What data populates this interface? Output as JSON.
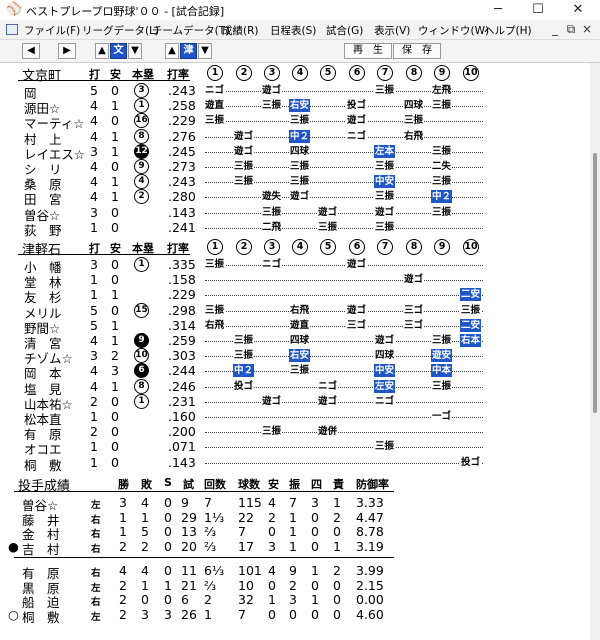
{
  "window": {
    "title": "ベストプレープロ野球'００ - [試合記録]",
    "controls": {
      "minimize": "─",
      "maximize": "☐",
      "close": "✕"
    }
  },
  "menu": {
    "items": [
      "ファイル(F)",
      "リーグデータ(L)",
      "チームデータ(T)",
      "成績(R)",
      "日程表(S)",
      "試合(G)",
      "表示(V)",
      "ウィンドウ(W)",
      "ヘルプ(H)"
    ],
    "mdi_controls": [
      "_",
      "⧉",
      "×"
    ]
  },
  "toolbar": {
    "prev": "◀",
    "next": "▶",
    "team1_up": "▲",
    "team1_label": "文",
    "team1_down": "▼",
    "team2_up": "▲",
    "team2_label": "津",
    "team2_down": "▼",
    "replay": "再　生",
    "save": "保　存"
  },
  "columns": {
    "at_bats": "打",
    "hits": "安",
    "homers": "本塁",
    "avg": "打率"
  },
  "innings": [
    "1",
    "2",
    "3",
    "4",
    "5",
    "6",
    "7",
    "8",
    "9",
    "10"
  ],
  "teams": [
    {
      "name": "文京町",
      "players": [
        {
          "pos": "",
          "name": "岡",
          "ab": "5",
          "h": "0",
          "hr": "3",
          "hr_filled": false,
          "avg": ".243",
          "results": [
            {
              "i": 1,
              "t": "ニゴ"
            },
            {
              "i": 3,
              "t": "遊ゴ"
            },
            {
              "i": 7,
              "t": "三振"
            },
            {
              "i": 9,
              "t": "左飛"
            }
          ]
        },
        {
          "pos": "",
          "name": "源田☆",
          "ab": "4",
          "h": "1",
          "hr": "1",
          "hr_filled": false,
          "avg": ".258",
          "results": [
            {
              "i": 1,
              "t": "遊直"
            },
            {
              "i": 3,
              "t": "三振"
            },
            {
              "i": 4,
              "t": "右安",
              "hit": true
            },
            {
              "i": 6,
              "t": "投ゴ"
            },
            {
              "i": 8,
              "t": "四球"
            },
            {
              "i": 9,
              "t": "三振"
            }
          ]
        },
        {
          "pos": "",
          "name": "マーティ☆",
          "ab": "4",
          "h": "0",
          "hr": "16",
          "hr_filled": false,
          "avg": ".229",
          "results": [
            {
              "i": 1,
              "t": "三振"
            },
            {
              "i": 4,
              "t": "三振"
            },
            {
              "i": 6,
              "t": "遊ゴ"
            },
            {
              "i": 8,
              "t": "三振"
            }
          ]
        },
        {
          "pos": "",
          "name": "村　上",
          "ab": "4",
          "h": "1",
          "hr": "8",
          "hr_filled": false,
          "avg": ".276",
          "results": [
            {
              "i": 2,
              "t": "遊ゴ"
            },
            {
              "i": 4,
              "t": "中２",
              "hit": true
            },
            {
              "i": 6,
              "t": "ニゴ"
            },
            {
              "i": 8,
              "t": "右飛"
            }
          ]
        },
        {
          "pos": "",
          "name": "レイエス☆",
          "ab": "3",
          "h": "1",
          "hr": "12",
          "hr_filled": true,
          "avg": ".245",
          "results": [
            {
              "i": 2,
              "t": "遊ゴ"
            },
            {
              "i": 4,
              "t": "四球"
            },
            {
              "i": 7,
              "t": "左本",
              "hit": true
            },
            {
              "i": 9,
              "t": "三振"
            }
          ]
        },
        {
          "pos": "",
          "name": "シ　リ",
          "ab": "4",
          "h": "0",
          "hr": "9",
          "hr_filled": false,
          "avg": ".273",
          "results": [
            {
              "i": 2,
              "t": "三振"
            },
            {
              "i": 4,
              "t": "三振"
            },
            {
              "i": 7,
              "t": "三振"
            },
            {
              "i": 9,
              "t": "二失"
            }
          ]
        },
        {
          "pos": "",
          "name": "桑　原",
          "ab": "4",
          "h": "1",
          "hr": "4",
          "hr_filled": false,
          "avg": ".243",
          "results": [
            {
              "i": 2,
              "t": "三振"
            },
            {
              "i": 4,
              "t": "三振"
            },
            {
              "i": 7,
              "t": "中安",
              "hit": true
            },
            {
              "i": 9,
              "t": "三振"
            }
          ]
        },
        {
          "pos": "",
          "name": "田　宮",
          "ab": "4",
          "h": "1",
          "hr": "2",
          "hr_filled": false,
          "avg": ".280",
          "results": [
            {
              "i": 3,
              "t": "遊失"
            },
            {
              "i": 4,
              "t": "遊ゴ"
            },
            {
              "i": 7,
              "t": "三振"
            },
            {
              "i": 9,
              "t": "中２",
              "hit": true
            }
          ]
        },
        {
          "pos": "",
          "name": "曽谷☆",
          "ab": "3",
          "h": "0",
          "hr": "",
          "hr_filled": false,
          "avg": ".143",
          "results": [
            {
              "i": 3,
              "t": "三振"
            },
            {
              "i": 5,
              "t": "遊ゴ"
            },
            {
              "i": 7,
              "t": "遊ゴ"
            },
            {
              "i": 9,
              "t": "三振"
            }
          ]
        },
        {
          "pos": "",
          "name": "荻　野",
          "ab": "1",
          "h": "0",
          "hr": "",
          "hr_filled": false,
          "avg": ".241",
          "results": [
            {
              "i": 3,
              "t": "二飛"
            },
            {
              "i": 5,
              "t": "三振"
            },
            {
              "i": 7,
              "t": "三振"
            }
          ]
        }
      ]
    },
    {
      "name": "津軽石",
      "players": [
        {
          "pos": "",
          "name": "小　幡",
          "ab": "3",
          "h": "0",
          "hr": "1",
          "hr_filled": false,
          "avg": ".335",
          "results": [
            {
              "i": 1,
              "t": "三振"
            },
            {
              "i": 3,
              "t": "ニゴ"
            },
            {
              "i": 6,
              "t": "遊ゴ"
            }
          ]
        },
        {
          "pos": "",
          "name": "堂　林",
          "ab": "1",
          "h": "0",
          "hr": "",
          "hr_filled": false,
          "avg": ".158",
          "results": [
            {
              "i": 8,
              "t": "遊ゴ"
            }
          ]
        },
        {
          "pos": "",
          "name": "友　杉",
          "ab": "1",
          "h": "1",
          "hr": "",
          "hr_filled": false,
          "avg": ".229",
          "results": [
            {
              "i": 10,
              "t": "二安",
              "hit": true
            }
          ]
        },
        {
          "pos": "",
          "name": "メリル",
          "ab": "5",
          "h": "0",
          "hr": "15",
          "hr_filled": false,
          "avg": ".298",
          "results": [
            {
              "i": 1,
              "t": "三振"
            },
            {
              "i": 4,
              "t": "右飛"
            },
            {
              "i": 6,
              "t": "遊ゴ"
            },
            {
              "i": 8,
              "t": "三ゴ"
            },
            {
              "i": 10,
              "t": "三振"
            }
          ]
        },
        {
          "pos": "",
          "name": "野間☆",
          "ab": "5",
          "h": "1",
          "hr": "",
          "hr_filled": false,
          "avg": ".314",
          "results": [
            {
              "i": 1,
              "t": "右飛"
            },
            {
              "i": 4,
              "t": "遊直"
            },
            {
              "i": 6,
              "t": "三ゴ"
            },
            {
              "i": 8,
              "t": "三ゴ"
            },
            {
              "i": 10,
              "t": "二安",
              "hit": true
            }
          ]
        },
        {
          "pos": "",
          "name": "清　宮",
          "ab": "4",
          "h": "1",
          "hr": "9",
          "hr_filled": true,
          "avg": ".259",
          "results": [
            {
              "i": 2,
              "t": "三振"
            },
            {
              "i": 4,
              "t": "四球"
            },
            {
              "i": 7,
              "t": "遊ゴ"
            },
            {
              "i": 9,
              "t": "三振"
            },
            {
              "i": 10,
              "t": "右本",
              "hit": true
            }
          ]
        },
        {
          "pos": "",
          "name": "チゾム☆",
          "ab": "3",
          "h": "2",
          "hr": "10",
          "hr_filled": false,
          "avg": ".303",
          "results": [
            {
              "i": 2,
              "t": "三振"
            },
            {
              "i": 4,
              "t": "右安",
              "hit": true
            },
            {
              "i": 7,
              "t": "四球"
            },
            {
              "i": 9,
              "t": "遊安",
              "hit": true
            }
          ]
        },
        {
          "pos": "",
          "name": "岡　本",
          "ab": "4",
          "h": "3",
          "hr": "6",
          "hr_filled": true,
          "avg": ".244",
          "results": [
            {
              "i": 2,
              "t": "中２",
              "hit": true
            },
            {
              "i": 4,
              "t": "三振"
            },
            {
              "i": 7,
              "t": "中安",
              "hit": true
            },
            {
              "i": 9,
              "t": "中本",
              "hit": true
            }
          ]
        },
        {
          "pos": "",
          "name": "塩　見",
          "ab": "4",
          "h": "1",
          "hr": "8",
          "hr_filled": false,
          "avg": ".246",
          "results": [
            {
              "i": 2,
              "t": "投ゴ"
            },
            {
              "i": 5,
              "t": "ニゴ"
            },
            {
              "i": 7,
              "t": "左安",
              "hit": true
            },
            {
              "i": 9,
              "t": "三振"
            }
          ]
        },
        {
          "pos": "",
          "name": "山本祐☆",
          "ab": "2",
          "h": "0",
          "hr": "1",
          "hr_filled": false,
          "avg": ".231",
          "results": [
            {
              "i": 3,
              "t": "遊ゴ"
            },
            {
              "i": 5,
              "t": "遊ゴ"
            },
            {
              "i": 7,
              "t": "ニゴ"
            }
          ]
        },
        {
          "pos": "",
          "name": "松本直",
          "ab": "1",
          "h": "0",
          "hr": "",
          "hr_filled": false,
          "avg": ".160",
          "results": [
            {
              "i": 9,
              "t": "一ゴ"
            }
          ]
        },
        {
          "pos": "",
          "name": "有　原",
          "ab": "2",
          "h": "0",
          "hr": "",
          "hr_filled": false,
          "avg": ".200",
          "results": [
            {
              "i": 3,
              "t": "三振"
            },
            {
              "i": 5,
              "t": "遊併"
            }
          ]
        },
        {
          "pos": "",
          "name": "オコエ",
          "ab": "1",
          "h": "0",
          "hr": "",
          "hr_filled": false,
          "avg": ".071",
          "results": [
            {
              "i": 7,
              "t": "三振"
            }
          ]
        },
        {
          "pos": "",
          "name": "桐　敷",
          "ab": "1",
          "h": "0",
          "hr": "",
          "hr_filled": false,
          "avg": ".143",
          "results": [
            {
              "i": 10,
              "t": "投ゴ"
            }
          ]
        }
      ]
    }
  ],
  "pitching": {
    "title": "投手成績",
    "headers": [
      "勝",
      "敗",
      "S",
      "試",
      "回数",
      "球数",
      "安",
      "振",
      "四",
      "責",
      "防御率"
    ],
    "groups": [
      [
        {
          "mark": "",
          "name": "曽谷☆",
          "hand": "左",
          "w": "3",
          "l": "4",
          "s": "0",
          "g": "9",
          "ip": "7",
          "pc": "115",
          "h": "4",
          "k": "7",
          "bb": "3",
          "er": "1",
          "era": "3.33"
        },
        {
          "mark": "",
          "name": "藤　井",
          "hand": "右",
          "w": "1",
          "l": "1",
          "s": "0",
          "g": "29",
          "ip": "1⅓",
          "pc": "22",
          "h": "2",
          "k": "1",
          "bb": "0",
          "er": "2",
          "era": "4.47"
        },
        {
          "mark": "",
          "name": "金　村",
          "hand": "右",
          "w": "1",
          "l": "5",
          "s": "0",
          "g": "13",
          "ip": "⅔",
          "pc": "7",
          "h": "0",
          "k": "1",
          "bb": "0",
          "er": "0",
          "era": "8.78"
        },
        {
          "mark": "●",
          "name": "吉　村",
          "hand": "右",
          "w": "2",
          "l": "2",
          "s": "0",
          "g": "20",
          "ip": "⅔",
          "pc": "17",
          "h": "3",
          "k": "1",
          "bb": "0",
          "er": "1",
          "era": "3.19"
        }
      ],
      [
        {
          "mark": "",
          "name": "有　原",
          "hand": "右",
          "w": "4",
          "l": "4",
          "s": "0",
          "g": "11",
          "ip": "6⅓",
          "pc": "101",
          "h": "4",
          "k": "9",
          "bb": "1",
          "er": "2",
          "era": "3.99"
        },
        {
          "mark": "",
          "name": "黒　原",
          "hand": "左",
          "w": "2",
          "l": "1",
          "s": "1",
          "g": "21",
          "ip": "⅔",
          "pc": "10",
          "h": "0",
          "k": "2",
          "bb": "0",
          "er": "0",
          "era": "2.15"
        },
        {
          "mark": "",
          "name": "船　迫",
          "hand": "右",
          "w": "2",
          "l": "0",
          "s": "0",
          "g": "6",
          "ip": "2",
          "pc": "32",
          "h": "1",
          "k": "3",
          "bb": "1",
          "er": "0",
          "era": "0.00"
        },
        {
          "mark": "○",
          "name": "桐　敷",
          "hand": "左",
          "w": "2",
          "l": "3",
          "s": "3",
          "g": "26",
          "ip": "1",
          "pc": "7",
          "h": "0",
          "k": "0",
          "bb": "0",
          "er": "0",
          "era": "4.60"
        }
      ]
    ]
  }
}
